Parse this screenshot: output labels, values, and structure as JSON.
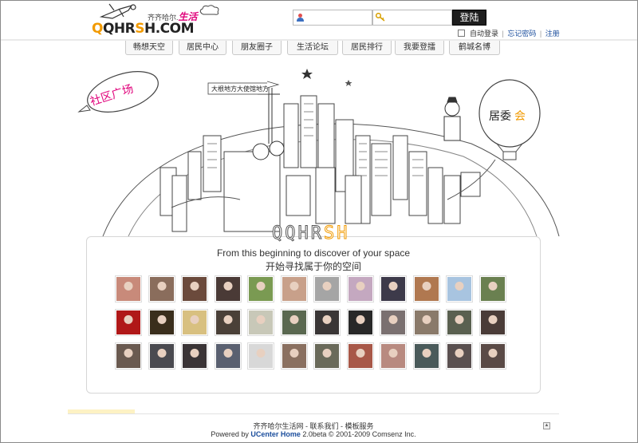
{
  "header": {
    "logo_text_a": "Q",
    "logo_text_b": "QHR",
    "logo_text_c": "S",
    "logo_text_d": "H.COM",
    "logo_sub": "齐齐哈尔.",
    "logo_sub_accent": "生活",
    "login_button": "登陆",
    "auto_login": "自动登录",
    "forgot_password": "忘记密码",
    "register": "注册",
    "separator": "|",
    "username_value": "",
    "password_value": ""
  },
  "nav": {
    "tabs": [
      {
        "label": "畅想天空"
      },
      {
        "label": "居民中心"
      },
      {
        "label": "朋友圈子"
      },
      {
        "label": "生活论坛"
      },
      {
        "label": "居民排行"
      },
      {
        "label": "我要登擂"
      },
      {
        "label": "鹤城名博"
      }
    ]
  },
  "scene": {
    "blimp_label": "社区广场",
    "sign_label": "大根地方大使馆地方",
    "balloon_label_a": "居委",
    "balloon_label_b": "会"
  },
  "main": {
    "brand_a": "QQHR",
    "brand_b": "SH",
    "tagline_en": "From this beginning to discover of your space",
    "tagline_cn": "开始寻找属于你的空间"
  },
  "avatars": {
    "colors": [
      "#c88a7a",
      "#8a6d5c",
      "#6b4a3c",
      "#4a3a36",
      "#7a9a52",
      "#c8a08a",
      "#a5a5a5",
      "#c4a8c0",
      "#3d3a4a",
      "#b07850",
      "#a8c4e0",
      "#6a8050",
      "#b01818",
      "#3a2e1c",
      "#d8c080",
      "#4a4038",
      "#c8c8b8",
      "#5a6850",
      "#3a3636",
      "#282828",
      "#7a7070",
      "#8a7a6a",
      "#5a6050",
      "#4a3c38",
      "#6a5a50",
      "#4a4a50",
      "#3a3436",
      "#5a6070",
      "#d8d8d8",
      "#8a7060",
      "#6a6a5a",
      "#a85848",
      "#b88a80",
      "#4a5a5a",
      "#5a5050",
      "#5a4a46"
    ]
  },
  "footer": {
    "links": [
      "齐齐哈尔生活网",
      "联系我们",
      "模板服务"
    ],
    "link_sep": " - ",
    "powered_prefix": "Powered by ",
    "powered_brand": "UCenter Home",
    "powered_suffix": " 2.0beta © 2001-2009 Comsenz Inc.",
    "top_icon": "up-arrow-icon"
  }
}
